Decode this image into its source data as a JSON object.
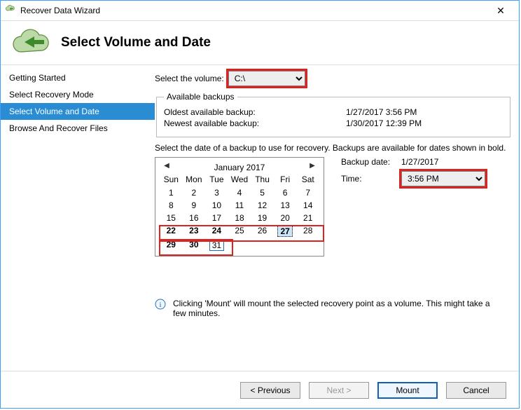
{
  "window": {
    "title": "Recover Data Wizard"
  },
  "header": {
    "heading": "Select Volume and Date"
  },
  "sidebar": {
    "items": [
      {
        "label": "Getting Started"
      },
      {
        "label": "Select Recovery Mode"
      },
      {
        "label": "Select Volume and Date"
      },
      {
        "label": "Browse And Recover Files"
      }
    ]
  },
  "main": {
    "volume_label": "Select the volume:",
    "volume_value": "C:\\",
    "available_backups": {
      "legend": "Available backups",
      "oldest_label": "Oldest available backup:",
      "oldest_value": "1/27/2017 3:56 PM",
      "newest_label": "Newest available backup:",
      "newest_value": "1/30/2017 12:39 PM"
    },
    "instruction": "Select the date of a backup to use for recovery. Backups are available for dates shown in bold.",
    "backup_date_label": "Backup date:",
    "backup_date_value": "1/27/2017",
    "time_label": "Time:",
    "time_value": "3:56 PM",
    "calendar": {
      "month_label": "January 2017",
      "dow": [
        "Sun",
        "Mon",
        "Tue",
        "Wed",
        "Thu",
        "Fri",
        "Sat"
      ],
      "weeks": [
        [
          1,
          2,
          3,
          4,
          5,
          6,
          7
        ],
        [
          8,
          9,
          10,
          11,
          12,
          13,
          14
        ],
        [
          15,
          16,
          17,
          18,
          19,
          20,
          21
        ],
        [
          22,
          23,
          24,
          25,
          26,
          27,
          28
        ],
        [
          29,
          30,
          31,
          null,
          null,
          null,
          null
        ]
      ],
      "bold_days": [
        22,
        23,
        24,
        27,
        29,
        30
      ],
      "selected_day": 27,
      "today": 31
    },
    "info_note": "Clicking 'Mount' will mount the selected recovery point as a volume. This might take a few minutes."
  },
  "footer": {
    "previous": "<  Previous",
    "next": "Next  >",
    "mount": "Mount",
    "cancel": "Cancel"
  }
}
